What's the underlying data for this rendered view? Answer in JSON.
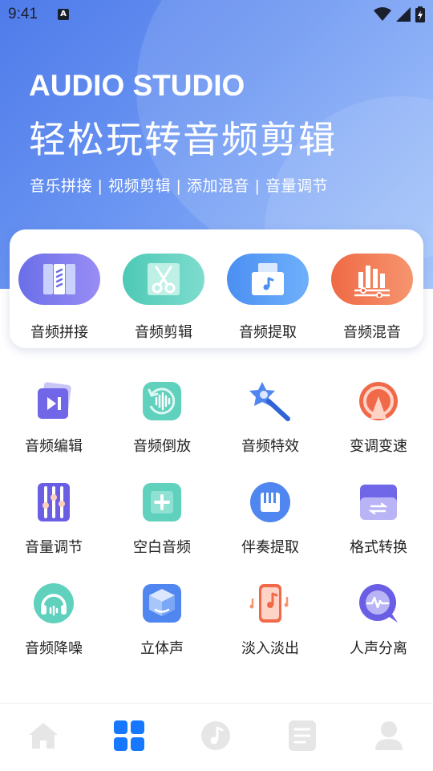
{
  "status_bar": {
    "time": "9:41",
    "sim_icon": "A"
  },
  "hero": {
    "title_en": "AUDIO STUDIO",
    "title_zh": "轻松玩转音频剪辑",
    "subtitle": "音乐拼接 | 视频剪辑 | 添加混音 | 音量调节"
  },
  "featured": [
    {
      "label": "音频拼接",
      "icon": "audio-merge-icon",
      "color": "#7b7ff0"
    },
    {
      "label": "音频剪辑",
      "icon": "scissors-icon",
      "color": "#5cd3c0"
    },
    {
      "label": "音频提取",
      "icon": "extract-icon",
      "color": "#5c9cf5"
    },
    {
      "label": "音频混音",
      "icon": "mixer-icon",
      "color": "#f2784e"
    }
  ],
  "tools": [
    {
      "label": "音频编辑",
      "icon": "audio-edit-icon"
    },
    {
      "label": "音频倒放",
      "icon": "reverse-icon"
    },
    {
      "label": "音频特效",
      "icon": "effects-wand-icon"
    },
    {
      "label": "变调变速",
      "icon": "pitch-speed-icon"
    },
    {
      "label": "音量调节",
      "icon": "volume-slider-icon"
    },
    {
      "label": "空白音频",
      "icon": "blank-audio-icon"
    },
    {
      "label": "伴奏提取",
      "icon": "piano-icon"
    },
    {
      "label": "格式转换",
      "icon": "format-convert-icon"
    },
    {
      "label": "音频降噪",
      "icon": "headphones-icon"
    },
    {
      "label": "立体声",
      "icon": "stereo-box-icon"
    },
    {
      "label": "淡入淡出",
      "icon": "fade-music-icon"
    },
    {
      "label": "人声分离",
      "icon": "voice-separate-icon"
    }
  ],
  "tabbar": [
    {
      "name": "home-tab",
      "icon": "home-icon",
      "active": false
    },
    {
      "name": "tools-tab",
      "icon": "grid-icon",
      "active": true
    },
    {
      "name": "music-tab",
      "icon": "music-note-icon",
      "active": false
    },
    {
      "name": "files-tab",
      "icon": "document-icon",
      "active": false
    },
    {
      "name": "profile-tab",
      "icon": "user-icon",
      "active": false
    }
  ],
  "colors": {
    "accent": "#1677ff",
    "inactive": "#e6e6e6",
    "hero_start": "#4f7bea",
    "hero_end": "#9cc0fb"
  }
}
